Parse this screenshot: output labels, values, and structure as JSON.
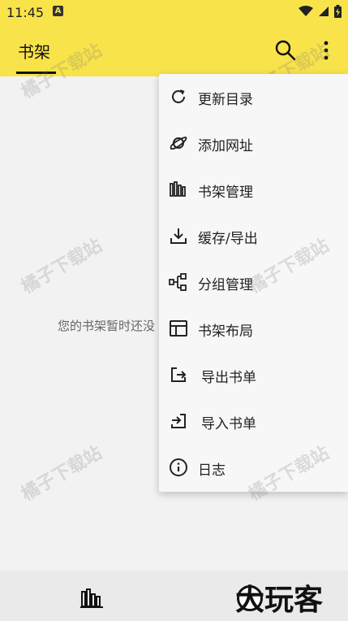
{
  "status": {
    "time": "11:45",
    "a_badge": "A"
  },
  "appbar": {
    "tab_label": "书架"
  },
  "main": {
    "empty_message": "您的书架暂时还没"
  },
  "menu": {
    "items": [
      {
        "label": "更新目录",
        "icon": "refresh-icon"
      },
      {
        "label": "添加网址",
        "icon": "planet-icon"
      },
      {
        "label": "书架管理",
        "icon": "books-icon"
      },
      {
        "label": "缓存/导出",
        "icon": "download-icon"
      },
      {
        "label": "分组管理",
        "icon": "group-icon"
      },
      {
        "label": "书架布局",
        "icon": "layout-icon"
      },
      {
        "label": "导出书单",
        "icon": "export-icon"
      },
      {
        "label": "导入书单",
        "icon": "import-icon"
      },
      {
        "label": "日志",
        "icon": "info-icon"
      }
    ]
  },
  "watermark": {
    "text": "橘子下载站"
  },
  "brand": {
    "text": "大玩客"
  },
  "colors": {
    "accent": "#f8e34b",
    "background": "#f2f2f2"
  }
}
